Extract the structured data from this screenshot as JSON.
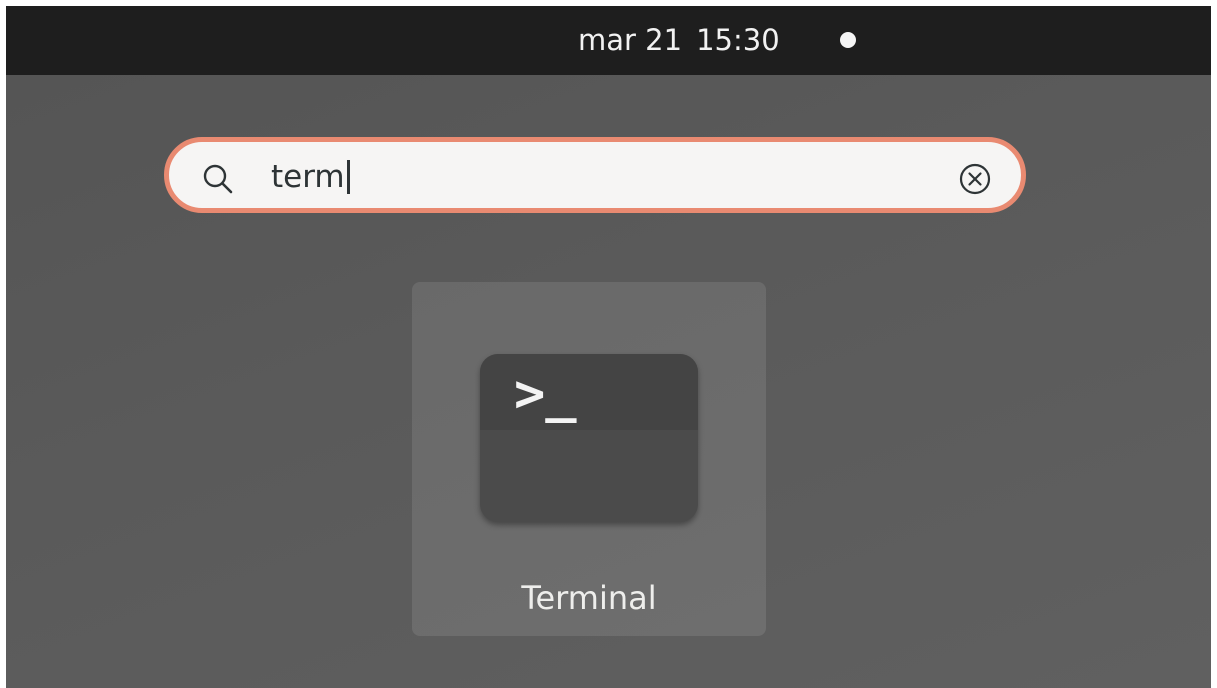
{
  "topbar": {
    "date": "mar 21",
    "time": "15:30",
    "status_icon": "circle-dot-icon"
  },
  "search": {
    "query": "term",
    "icon": "search-icon",
    "clear_icon": "clear-icon",
    "accent_color": "#e98a71"
  },
  "results": [
    {
      "label": "Terminal",
      "icon": "terminal-icon",
      "prompt_glyph": ">_"
    }
  ]
}
